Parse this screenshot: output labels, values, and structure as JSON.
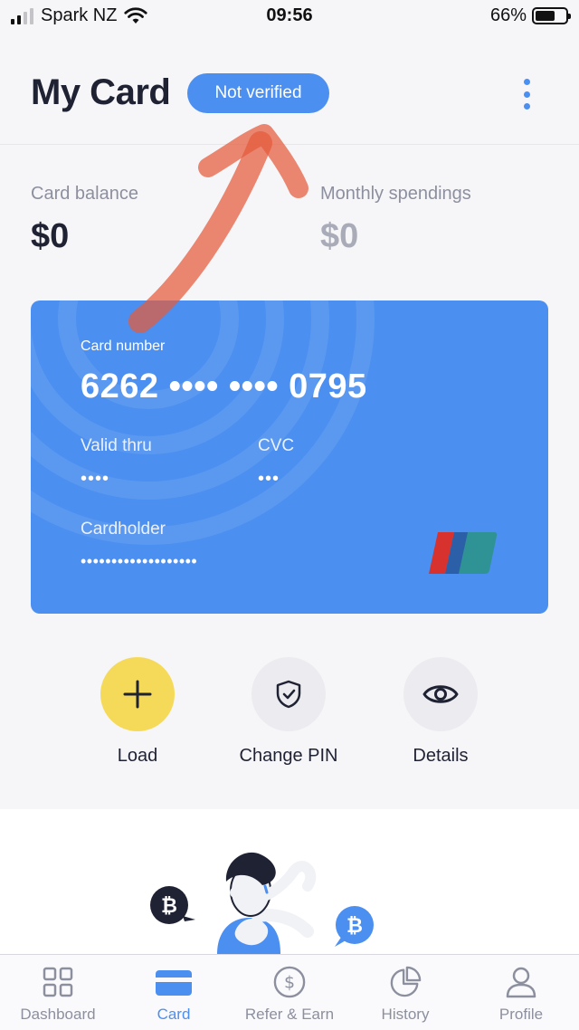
{
  "status_bar": {
    "carrier": "Spark NZ",
    "time": "09:56",
    "battery": "66%",
    "battery_level": 0.66
  },
  "header": {
    "title": "My Card",
    "badge": "Not verified",
    "accent_color": "#4b8ff0"
  },
  "balances": {
    "card_balance_label": "Card balance",
    "card_balance_value": "$0",
    "monthly_label": "Monthly spendings",
    "monthly_value": "$0"
  },
  "card": {
    "number_label": "Card number",
    "number": "6262 •••• •••• 0795",
    "valid_label": "Valid thru",
    "valid_value": "••••",
    "cvc_label": "CVC",
    "cvc_value": "•••",
    "holder_label": "Cardholder",
    "holder_value": "•••••••••••••••••••",
    "logo_icon": "unionpay-logo"
  },
  "actions": [
    {
      "label": "Load",
      "icon": "plus-icon"
    },
    {
      "label": "Change PIN",
      "icon": "shield-check-icon"
    },
    {
      "label": "Details",
      "icon": "eye-icon"
    }
  ],
  "tabs": [
    {
      "label": "Dashboard",
      "icon": "grid-icon",
      "active": false
    },
    {
      "label": "Card",
      "icon": "card-icon",
      "active": true
    },
    {
      "label": "Refer & Earn",
      "icon": "dollar-coin-icon",
      "active": false
    },
    {
      "label": "History",
      "icon": "pie-chart-icon",
      "active": false
    },
    {
      "label": "Profile",
      "icon": "person-icon",
      "active": false
    }
  ]
}
